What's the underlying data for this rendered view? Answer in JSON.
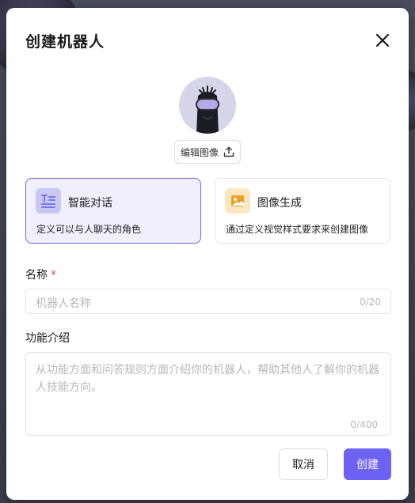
{
  "dialog": {
    "title": "创建机器人",
    "edit_image_label": "编辑图像"
  },
  "modes": [
    {
      "title": "智能对话",
      "description": "定义可以与人聊天的角色",
      "selected": true,
      "icon": "text-lines-icon",
      "icon_bg": "#c9c8f5",
      "icon_color": "#6b6ae6"
    },
    {
      "title": "图像生成",
      "description": "通过定义视觉样式要求来创建图像",
      "selected": false,
      "icon": "image-icon",
      "icon_bg": "#fde7c0",
      "icon_color": "#f0a020"
    }
  ],
  "form": {
    "name_label": "名称",
    "name_required_mark": "*",
    "name_placeholder": "机器人名称",
    "name_counter": "0/20",
    "desc_label": "功能介绍",
    "desc_placeholder": "从功能方面和问答规则方面介绍你的机器人，帮助其他人了解你的机器人技能方向。",
    "desc_counter": "0/400"
  },
  "actions": {
    "cancel_label": "取消",
    "create_label": "创建"
  },
  "colors": {
    "accent": "#6c63f5",
    "required": "#e5484d"
  }
}
